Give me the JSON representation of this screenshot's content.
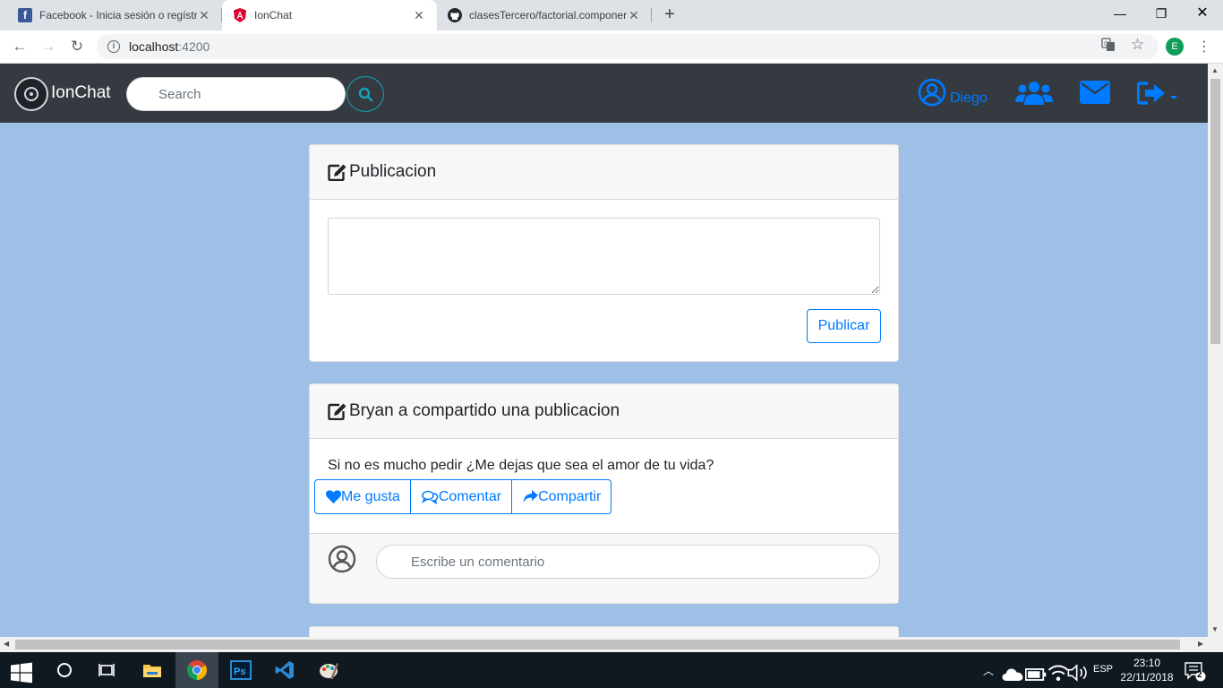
{
  "browser": {
    "tabs": [
      {
        "title": "Facebook - Inicia sesión o regístr",
        "icon": "facebook-icon"
      },
      {
        "title": "IonChat",
        "icon": "angular-icon"
      },
      {
        "title": "clasesTercero/factorial.componer",
        "icon": "github-icon"
      }
    ],
    "url_host": "localhost",
    "url_port": ":4200",
    "profile_initial": "E"
  },
  "app": {
    "brand": "IonChat",
    "search_placeholder": "Search",
    "user_name": "Diego",
    "colors": {
      "navbar": "#343a40",
      "accent": "#007bff",
      "page_bg": "#9ec0e6",
      "search_btn_border": "#17a2b8"
    }
  },
  "compose": {
    "title": "Publicacion",
    "button": "Publicar"
  },
  "post": {
    "title": "Bryan a compartido una publicacion",
    "text": "Si no es mucho pedir ¿Me dejas que sea el amor de tu vida?",
    "actions": {
      "like": "Me gusta",
      "comment": "Comentar",
      "share": "Compartir"
    },
    "comment_placeholder": "Escribe un comentario"
  },
  "taskbar": {
    "language": "ESP",
    "time": "23:10",
    "date": "22/11/2018",
    "notifications": "2"
  }
}
